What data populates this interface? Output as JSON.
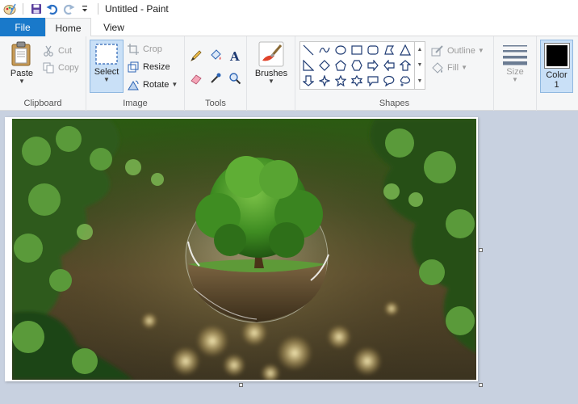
{
  "window": {
    "title": "Untitled - Paint"
  },
  "quick_access": {
    "icons": [
      "paint-app-icon",
      "save-icon",
      "undo-icon",
      "redo-icon",
      "customize-dropdown-icon"
    ]
  },
  "tabs": [
    {
      "label": "File"
    },
    {
      "label": "Home"
    },
    {
      "label": "View"
    }
  ],
  "ribbon": {
    "clipboard": {
      "label": "Clipboard",
      "paste": "Paste",
      "cut": "Cut",
      "copy": "Copy"
    },
    "image": {
      "label": "Image",
      "select": "Select",
      "crop": "Crop",
      "resize": "Resize",
      "rotate": "Rotate"
    },
    "tools": {
      "label": "Tools",
      "items": [
        "pencil-icon",
        "fill-bucket-icon",
        "text-icon",
        "eraser-icon",
        "color-picker-icon",
        "magnifier-icon"
      ]
    },
    "brushes": {
      "label": "Brushes"
    },
    "shapes": {
      "label": "Shapes",
      "outline": "Outline",
      "fill": "Fill"
    },
    "size": {
      "label": "Size"
    },
    "color1": {
      "label_line1": "Color",
      "label_line2": "1",
      "value": "#000000"
    }
  },
  "colors": {
    "file_tab": "#1979ca",
    "ribbon_bg": "#f5f6f7",
    "workspace_bg": "#c8d1e0",
    "selected_button": "#c9e0f7"
  }
}
